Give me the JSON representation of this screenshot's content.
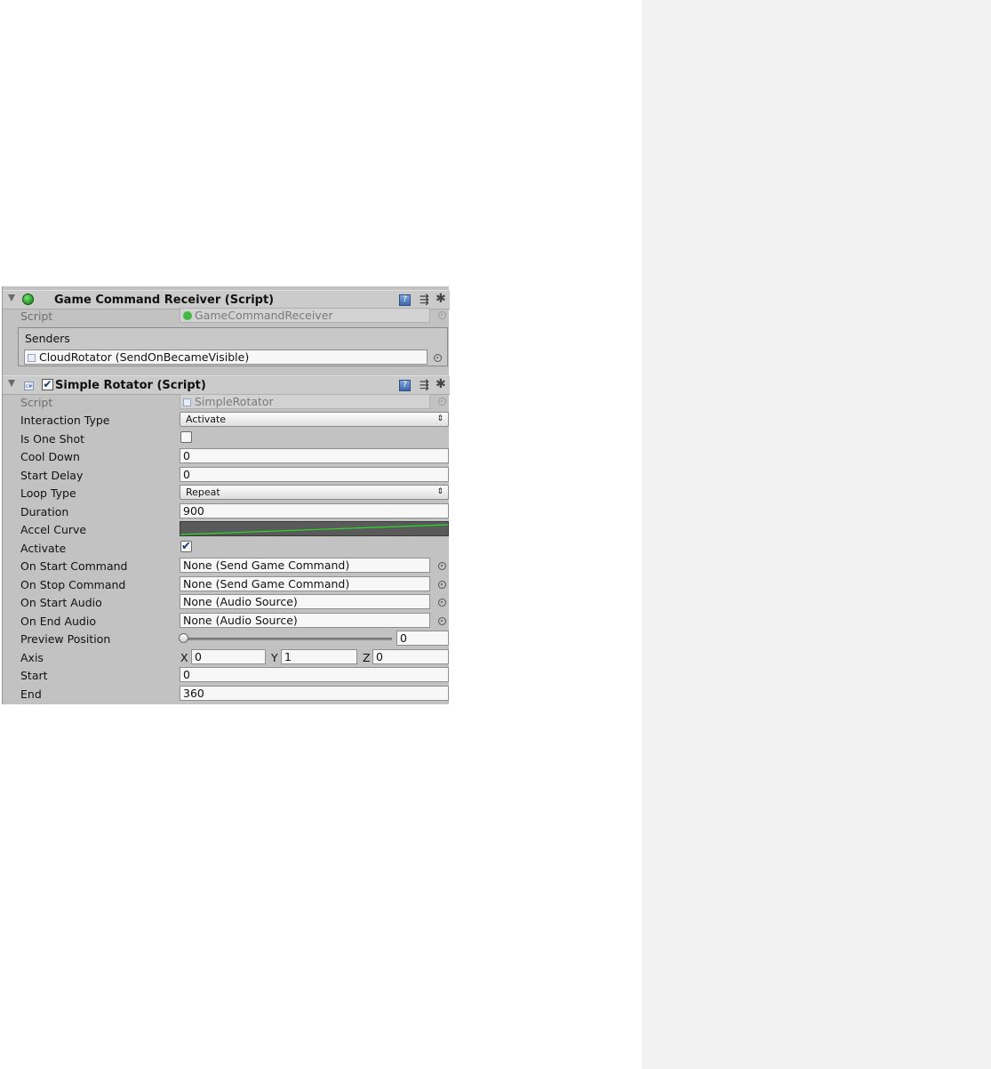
{
  "components": {
    "receiver": {
      "title": "Game Command Receiver (Script)",
      "script_label": "Script",
      "script_value": "GameCommandReceiver",
      "senders_label": "Senders",
      "senders": [
        "CloudRotator (SendOnBecameVisible)"
      ]
    },
    "rotator": {
      "title": "Simple Rotator (Script)",
      "enabled": true,
      "script_label": "Script",
      "script_value": "SimpleRotator",
      "fields": {
        "interaction_type": {
          "label": "Interaction Type",
          "value": "Activate"
        },
        "is_one_shot": {
          "label": "Is One Shot",
          "checked": false
        },
        "cool_down": {
          "label": "Cool Down",
          "value": "0"
        },
        "start_delay": {
          "label": "Start Delay",
          "value": "0"
        },
        "loop_type": {
          "label": "Loop Type",
          "value": "Repeat"
        },
        "duration": {
          "label": "Duration",
          "value": "900"
        },
        "accel_curve": {
          "label": "Accel Curve",
          "curve_color": "#29d929"
        },
        "activate": {
          "label": "Activate",
          "checked": true,
          "glyph": "✔"
        },
        "on_start_command": {
          "label": "On Start Command",
          "value": "None (Send Game Command)"
        },
        "on_stop_command": {
          "label": "On Stop Command",
          "value": "None (Send Game Command)"
        },
        "on_start_audio": {
          "label": "On Start Audio",
          "value": "None (Audio Source)"
        },
        "on_end_audio": {
          "label": "On End Audio",
          "value": "None (Audio Source)"
        },
        "preview_position": {
          "label": "Preview Position",
          "value": "0"
        },
        "axis": {
          "label": "Axis",
          "x_label": "X",
          "x": "0",
          "y_label": "Y",
          "y": "1",
          "z_label": "Z",
          "z": "0"
        },
        "start": {
          "label": "Start",
          "value": "0"
        },
        "end": {
          "label": "End",
          "value": "360"
        }
      }
    }
  },
  "icons": {
    "help": "help-book-icon",
    "preset": "preset-icon",
    "gear": "gear-icon",
    "object_picker": "object-picker-icon",
    "dropdown_arrows": "⇕",
    "gear_glyph": "✱",
    "preset_glyph": "⇶",
    "help_glyph": "?",
    "cs_glyph": "c#",
    "checkmark": "✔"
  },
  "colors": {
    "inspector_bg": "#c2c2c2",
    "side_panel_bg": "#f2f2f2",
    "accel_curve": "#29d929"
  }
}
